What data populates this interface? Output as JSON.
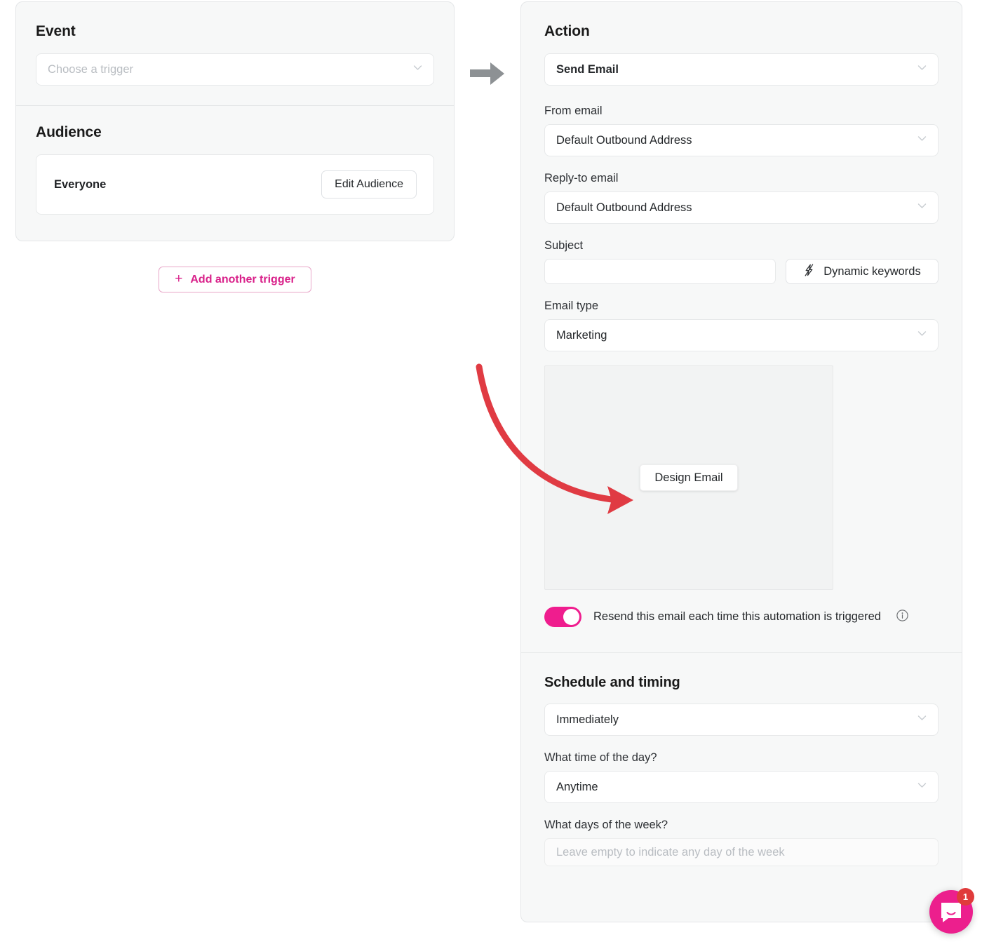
{
  "trigger_panel": {
    "event": {
      "title": "Event",
      "select_placeholder": "Choose a trigger",
      "chevron_icon": "chevron-down-icon"
    },
    "audience": {
      "title": "Audience",
      "name": "Everyone",
      "edit_button": "Edit Audience"
    },
    "add_trigger_button": "Add another trigger",
    "add_trigger_plus_icon": "plus-icon"
  },
  "connector": {
    "icon": "arrow-right-icon"
  },
  "action_panel": {
    "title": "Action",
    "action_select_value": "Send Email",
    "from_email": {
      "label": "From email",
      "value": "Default Outbound Address"
    },
    "reply_to_email": {
      "label": "Reply-to email",
      "value": "Default Outbound Address"
    },
    "subject": {
      "label": "Subject",
      "value": "",
      "placeholder": "",
      "keywords_button": "Dynamic keywords",
      "keywords_icon": "lightning-bolt-icon"
    },
    "email_type": {
      "label": "Email type",
      "value": "Marketing"
    },
    "design_email_button": "Design Email",
    "resend_toggle": {
      "label": "Resend this email each time this automation is triggered",
      "state": "on",
      "info_icon": "info-circle-icon"
    },
    "schedule": {
      "title": "Schedule and timing",
      "when_value": "Immediately",
      "time_label": "What time of the day?",
      "time_value": "Anytime",
      "days_label": "What days of the week?",
      "days_placeholder": "Leave empty to indicate any day of the week"
    }
  },
  "annotation": {
    "type": "curved-arrow",
    "color": "#e03b43",
    "points_to": "design-email-button"
  },
  "messenger": {
    "icon": "chat-bubble-icon",
    "badge_count": "1",
    "color": "#ec1f8d"
  },
  "colors": {
    "accent_pink": "#ef1d8e",
    "link_pink": "#d9218a",
    "panel_bg": "#f7f8f8",
    "border": "#e4e6e8",
    "annotation_red": "#e03b43"
  }
}
